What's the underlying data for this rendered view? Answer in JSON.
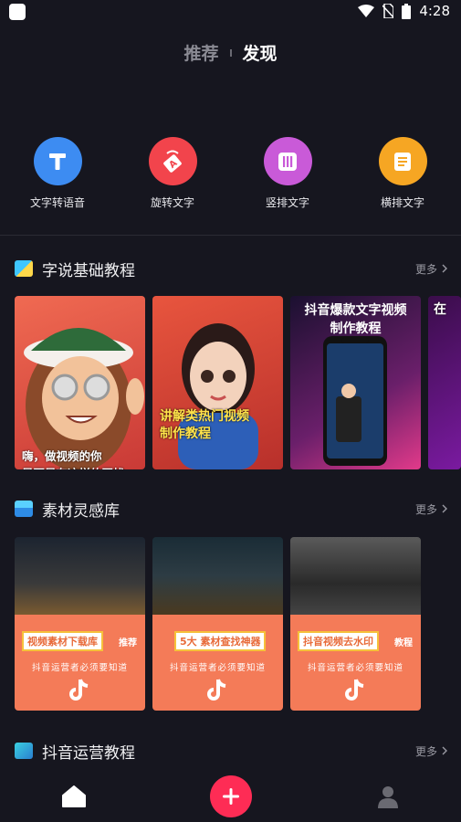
{
  "status_bar": {
    "time": "4:28",
    "icons": [
      "app-notification-icon",
      "wifi-icon",
      "no-sim-icon",
      "battery-icon"
    ]
  },
  "top_tabs": [
    {
      "label": "推荐",
      "active": false
    },
    {
      "label": "发现",
      "active": true
    }
  ],
  "tools": [
    {
      "label": "文字转语音",
      "icon": "text-t-icon",
      "color": "#3d8cf2"
    },
    {
      "label": "旋转文字",
      "icon": "rotate-text-icon",
      "color": "#f2444c"
    },
    {
      "label": "竖排文字",
      "icon": "vertical-text-icon",
      "color": "#c95ad8"
    },
    {
      "label": "横排文字",
      "icon": "horizontal-text-icon",
      "color": "#f6a623"
    }
  ],
  "sections": {
    "basic": {
      "title": "字说基础教程",
      "more": "更多",
      "cards": [
        {
          "caption": "嗨，做视频的你\n是不是有这样的困扰"
        },
        {
          "caption": "讲解类热门视频\n制作教程"
        },
        {
          "title": "抖音爆款文字视频\n制作教程"
        },
        {
          "title": "在"
        }
      ]
    },
    "materials": {
      "title": "素材灵感库",
      "more": "更多",
      "cards": [
        {
          "banner": "视频素材下载库",
          "tag": "推荐",
          "subtitle": "抖音运营者必须要知道"
        },
        {
          "banner": "5大 素材查找神器",
          "subtitle": "抖音运营者必须要知道"
        },
        {
          "banner": "抖音视频去水印",
          "tag": "教程",
          "subtitle": "抖音运营者必须要知道"
        }
      ]
    },
    "operations": {
      "title": "抖音运营教程",
      "more": "更多"
    }
  },
  "bottom_nav": [
    "home-icon",
    "add-icon",
    "profile-icon"
  ],
  "colors": {
    "background": "#16161f",
    "accent_red": "#fe2c55",
    "material_orange": "#f47b58"
  }
}
